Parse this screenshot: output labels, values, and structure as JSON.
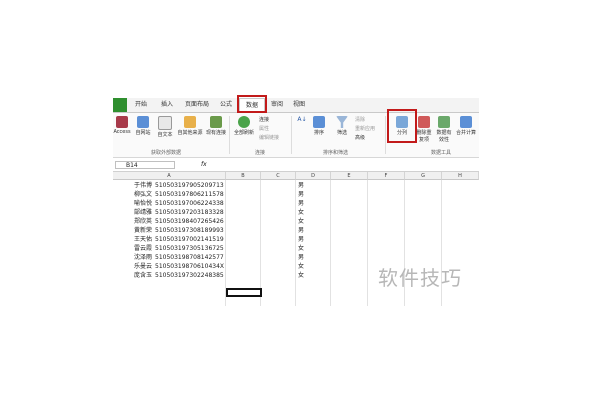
{
  "menubar": {
    "tabs": [
      {
        "id": "home",
        "label": "开始"
      },
      {
        "id": "insert",
        "label": "插入"
      },
      {
        "id": "layout",
        "label": "页面布局"
      },
      {
        "id": "formulas",
        "label": "公式"
      },
      {
        "id": "data",
        "label": "数据"
      },
      {
        "id": "review",
        "label": "审阅"
      },
      {
        "id": "view",
        "label": "视图"
      }
    ]
  },
  "ribbon": {
    "get_external": {
      "access": "Access",
      "web": "自网站",
      "text": "自文本",
      "other": "自其他来源",
      "existing": "现有连接",
      "group": "获取外部数据"
    },
    "connections": {
      "refresh": "全部刷新",
      "conn": "连接",
      "props": "属性",
      "edit": "编辑链接",
      "group": "连接"
    },
    "sort_filter": {
      "sort": "排序",
      "filter": "筛选",
      "clear": "清除",
      "reapply": "重新应用",
      "advanced": "高级",
      "group": "排序和筛选"
    },
    "data_tools": {
      "split": "分列",
      "remove_dup": "删除重复项",
      "validation": "数据有效性",
      "consolidate": "合并计算",
      "group": "数据工具"
    }
  },
  "formula_bar": {
    "name_box": "B14",
    "fx": "fx"
  },
  "columns": [
    "A",
    "B",
    "C",
    "D",
    "E",
    "F",
    "G",
    "H"
  ],
  "rows": [
    {
      "name": "于伟博",
      "id": "510503197905209713",
      "sex": "男"
    },
    {
      "name": "柳弘文",
      "id": "510503197806211578",
      "sex": "男"
    },
    {
      "name": "喻怡悦",
      "id": "510503197006224338",
      "sex": "男"
    },
    {
      "name": "郜靖雅",
      "id": "510503197203183328",
      "sex": "女"
    },
    {
      "name": "郑欣英",
      "id": "510503198407265426",
      "sex": "女"
    },
    {
      "name": "黄新荣",
      "id": "510503197308189993",
      "sex": "男"
    },
    {
      "name": "王天佑",
      "id": "510503197002141519",
      "sex": "男"
    },
    {
      "name": "雷云霞",
      "id": "510503197305136725",
      "sex": "女"
    },
    {
      "name": "沈泽雨",
      "id": "510503198708142577",
      "sex": "男"
    },
    {
      "name": "乐曼云",
      "id": "51050319870610434X",
      "sex": "女"
    },
    {
      "name": "庞含玉",
      "id": "510503197302248385",
      "sex": "女"
    }
  ],
  "watermark": "软件技巧",
  "colors": {
    "highlight": "#c21a1a",
    "file_tab": "#2f8f2f",
    "selection": "#111111"
  }
}
